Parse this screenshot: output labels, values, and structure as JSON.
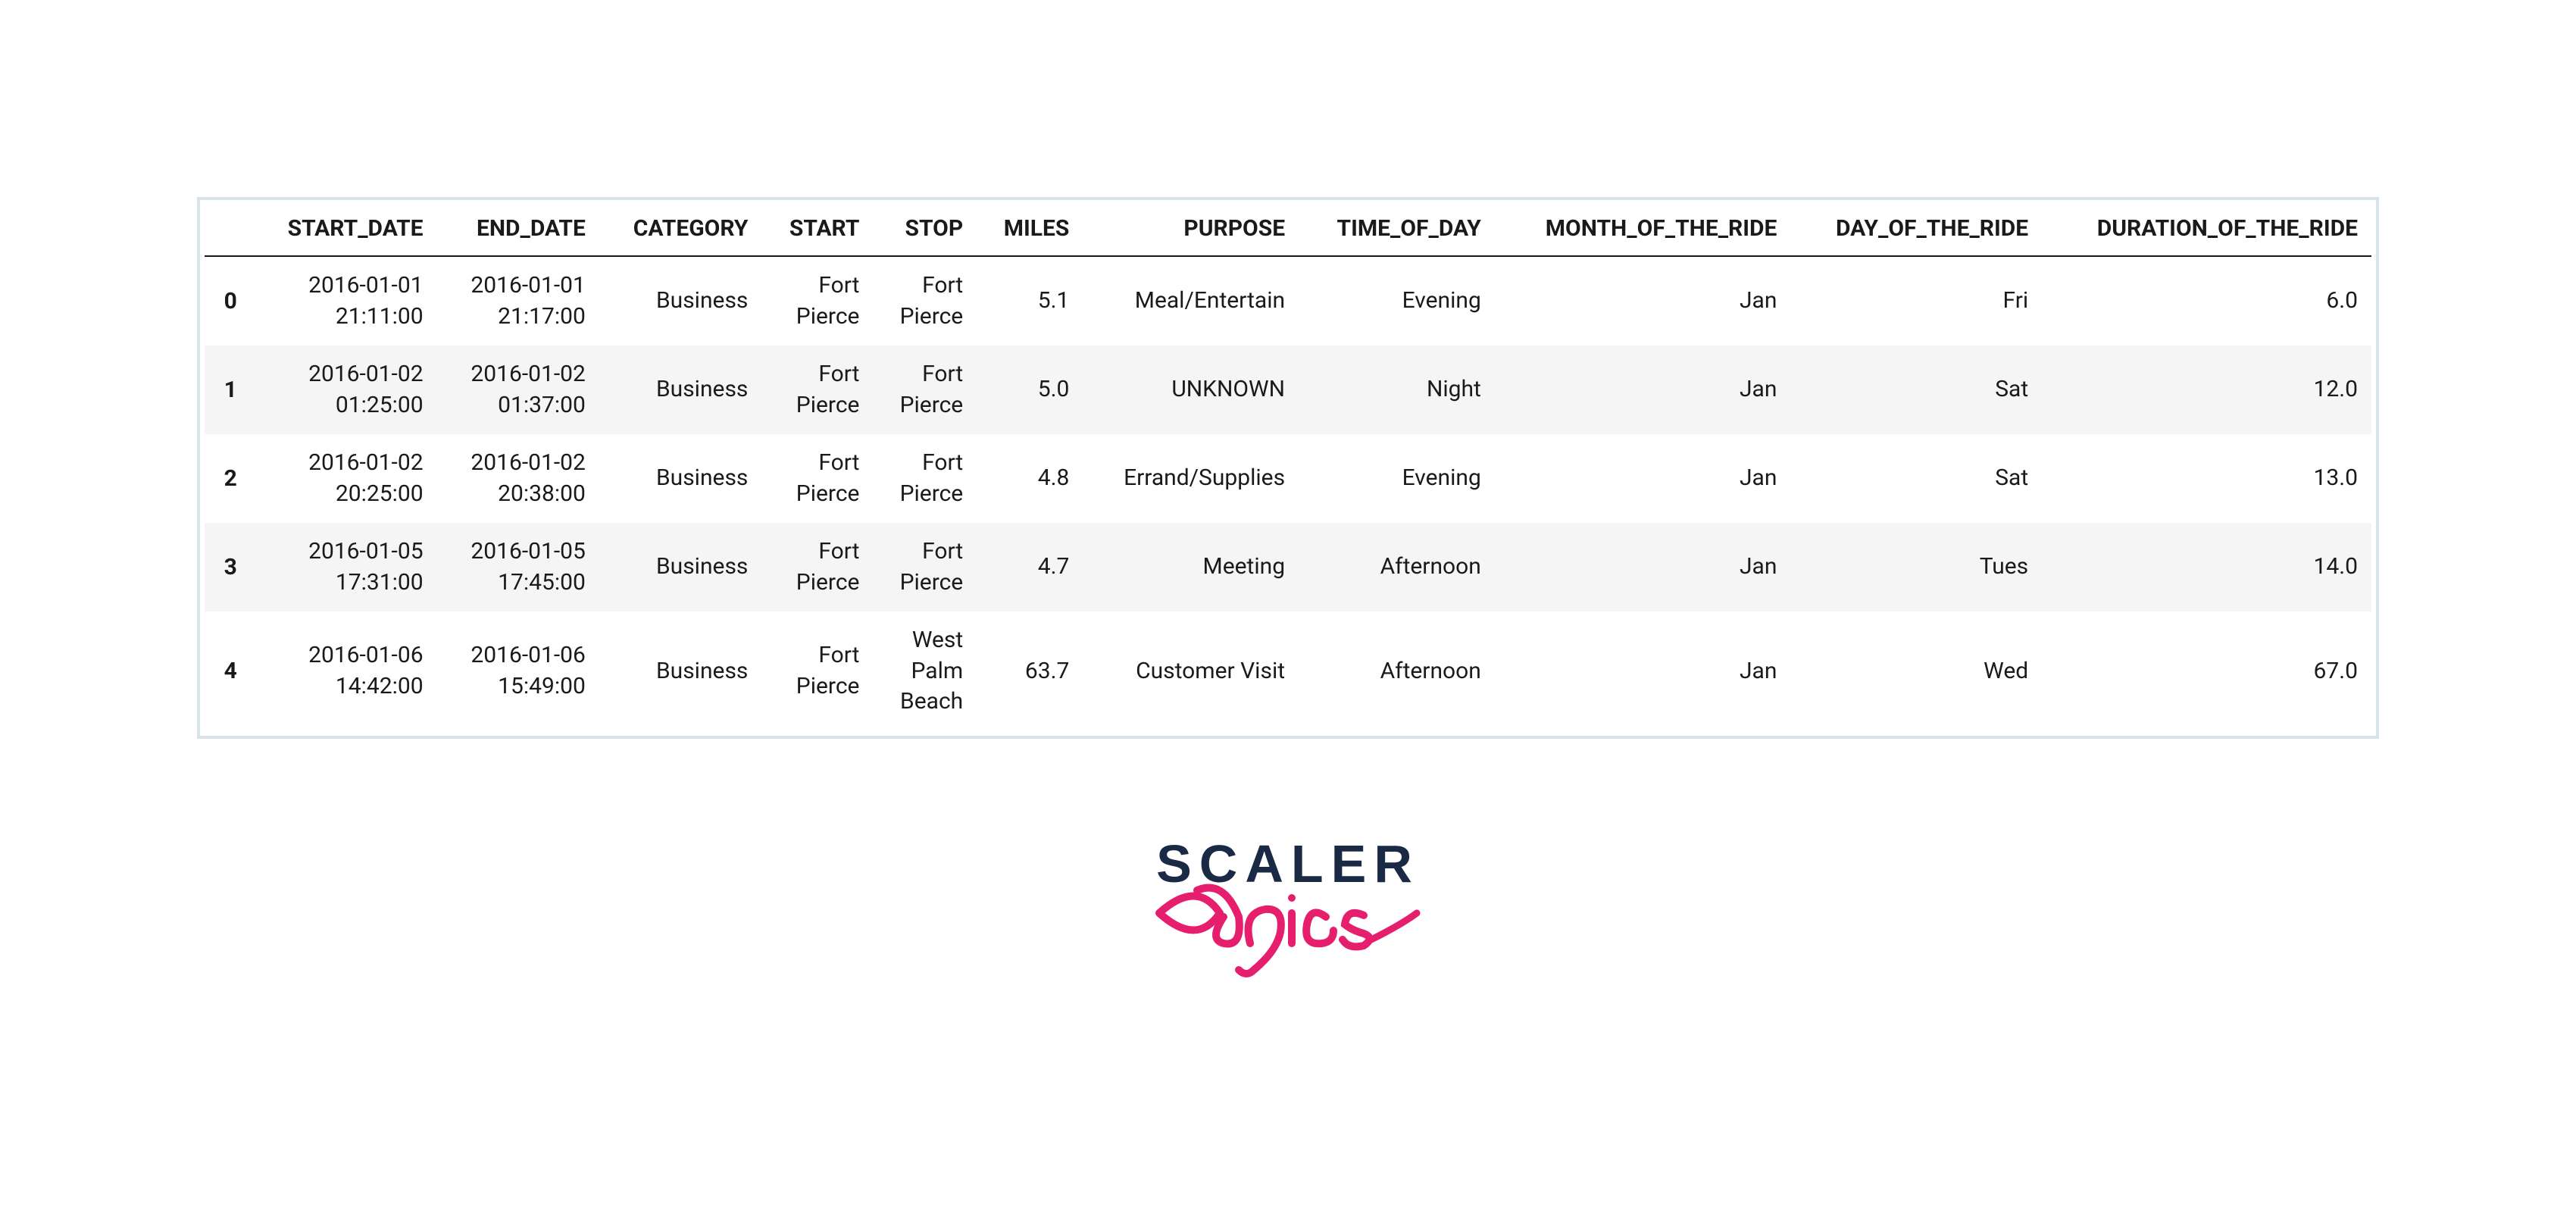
{
  "table": {
    "headers": [
      "",
      "START_DATE",
      "END_DATE",
      "CATEGORY",
      "START",
      "STOP",
      "MILES",
      "PURPOSE",
      "TIME_OF_DAY",
      "MONTH_OF_THE_RIDE",
      "DAY_OF_THE_RIDE",
      "DURATION_OF_THE_RIDE"
    ],
    "rows": [
      {
        "idx": "0",
        "start_date": "2016-01-01\n21:11:00",
        "end_date": "2016-01-01\n21:17:00",
        "category": "Business",
        "start": "Fort\nPierce",
        "stop": "Fort\nPierce",
        "miles": "5.1",
        "purpose": "Meal/Entertain",
        "time_of_day": "Evening",
        "month_of_the_ride": "Jan",
        "day_of_the_ride": "Fri",
        "duration_of_the_ride": "6.0"
      },
      {
        "idx": "1",
        "start_date": "2016-01-02\n01:25:00",
        "end_date": "2016-01-02\n01:37:00",
        "category": "Business",
        "start": "Fort\nPierce",
        "stop": "Fort\nPierce",
        "miles": "5.0",
        "purpose": "UNKNOWN",
        "time_of_day": "Night",
        "month_of_the_ride": "Jan",
        "day_of_the_ride": "Sat",
        "duration_of_the_ride": "12.0"
      },
      {
        "idx": "2",
        "start_date": "2016-01-02\n20:25:00",
        "end_date": "2016-01-02\n20:38:00",
        "category": "Business",
        "start": "Fort\nPierce",
        "stop": "Fort\nPierce",
        "miles": "4.8",
        "purpose": "Errand/Supplies",
        "time_of_day": "Evening",
        "month_of_the_ride": "Jan",
        "day_of_the_ride": "Sat",
        "duration_of_the_ride": "13.0"
      },
      {
        "idx": "3",
        "start_date": "2016-01-05\n17:31:00",
        "end_date": "2016-01-05\n17:45:00",
        "category": "Business",
        "start": "Fort\nPierce",
        "stop": "Fort\nPierce",
        "miles": "4.7",
        "purpose": "Meeting",
        "time_of_day": "Afternoon",
        "month_of_the_ride": "Jan",
        "day_of_the_ride": "Tues",
        "duration_of_the_ride": "14.0"
      },
      {
        "idx": "4",
        "start_date": "2016-01-06\n14:42:00",
        "end_date": "2016-01-06\n15:49:00",
        "category": "Business",
        "start": "Fort\nPierce",
        "stop": "West\nPalm\nBeach",
        "miles": "63.7",
        "purpose": "Customer Visit",
        "time_of_day": "Afternoon",
        "month_of_the_ride": "Jan",
        "day_of_the_ride": "Wed",
        "duration_of_the_ride": "67.0"
      }
    ]
  },
  "logo": {
    "line1": "SCALER",
    "line2": "Topics"
  }
}
